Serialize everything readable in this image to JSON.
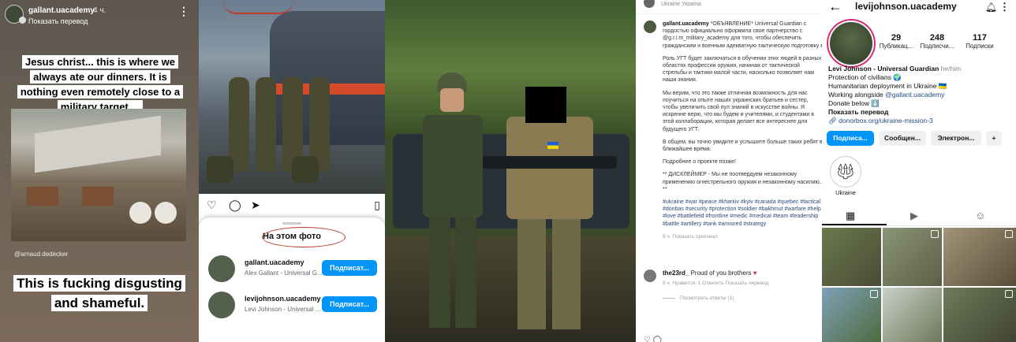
{
  "story": {
    "username": "gallant.uacademy",
    "time": "4 ч.",
    "translate": "Показать перевод",
    "caption_top": "Jesus christ... this is where we always ate our dinners. It is nothing even remotely close to a military target....",
    "credit": "@arnaud.dedecker",
    "caption_bottom": "This is fucking disgusting and shameful."
  },
  "tags": {
    "sheet_title": "На этом фото",
    "rows": [
      {
        "username": "gallant.uacademy",
        "name": "Alex Gallant - Universal G...",
        "button": "Подписат..."
      },
      {
        "username": "levijohnson.uacademy",
        "name": "Levi Johnson - Universal ...",
        "button": "Подписат..."
      }
    ]
  },
  "post": {
    "location": "Ukraine Україна",
    "username": "gallant.uacademy",
    "paragraphs": [
      "*ОБЪЯВЛЕНИЕ* Universal Guardian с гордостью официально оформила свое партнерство с @g.r.i.m_military_academy для того, чтобы обеспечить гражданским и военным адекватную тактическую подготовку в",
      "Роль УГТ будет заключаться в обучении этих людей в разных областях профессии оружия, начиная от тактической стрельбы и тактики малой части, насколько позволяет нам наши знания.",
      "Мы верим, что это также отличная возможность для нас поучиться на опыте наших украинских братьев и сестер, чтобы увеличить свой пул знаний в искусстве войны. Я искренне верю, что мы будем и учителями, и студентами в этой коллаборации, которая делает все интереснее для будущего УГТ.",
      "В общем, вы точно увидите и услышите больше таких ребят в ближайшее время.",
      "Подробнее о проекте позже!",
      "** ДИСКЛЕЙМЕР - Мы не поотвердуем незаконному применению огнестрельного оружия и незаконному насилию.. **"
    ],
    "hashtags": "#ukraine #war #peace #kharkiv #kyiv #canada #quebec #tactical #donbas #security #protection #soldier #bakhmut #warfare #help #love #battlefield #frontline #medic #medical #team #leadership #battle #artillery #tank #armored #strategy",
    "meta": "9 ч.   Показать оригинал",
    "comment": {
      "username": "the23rd_",
      "text": "Proud of you brothers",
      "heart": "♥",
      "meta": "9 ч.   Нравится: 1   Ответить   Показать перевод"
    },
    "replies": "Посмотреть ответы (1)"
  },
  "profile": {
    "username": "levijohnson.uacademy",
    "stats": [
      {
        "num": "29",
        "label": "Публикац..."
      },
      {
        "num": "248",
        "label": "Подписчи..."
      },
      {
        "num": "117",
        "label": "Подписки"
      }
    ],
    "name": "Levi Johnson - Universal Guardian",
    "pronouns": "he/him",
    "bio_lines": [
      "Protection of civilians 🌍",
      "Humanitarian deployment in Ukraine 🇺🇦"
    ],
    "working_prefix": "Working alongside ",
    "working_link": "@gallant.uacademy",
    "donate": "Donate below ⬇️",
    "translate": "Показать перевод",
    "link": "donorbox.org/ukraine-mission-3",
    "buttons": [
      "Подписа...",
      "Сообщен...",
      "Электрон..."
    ],
    "highlight_label": "Ukraine"
  }
}
